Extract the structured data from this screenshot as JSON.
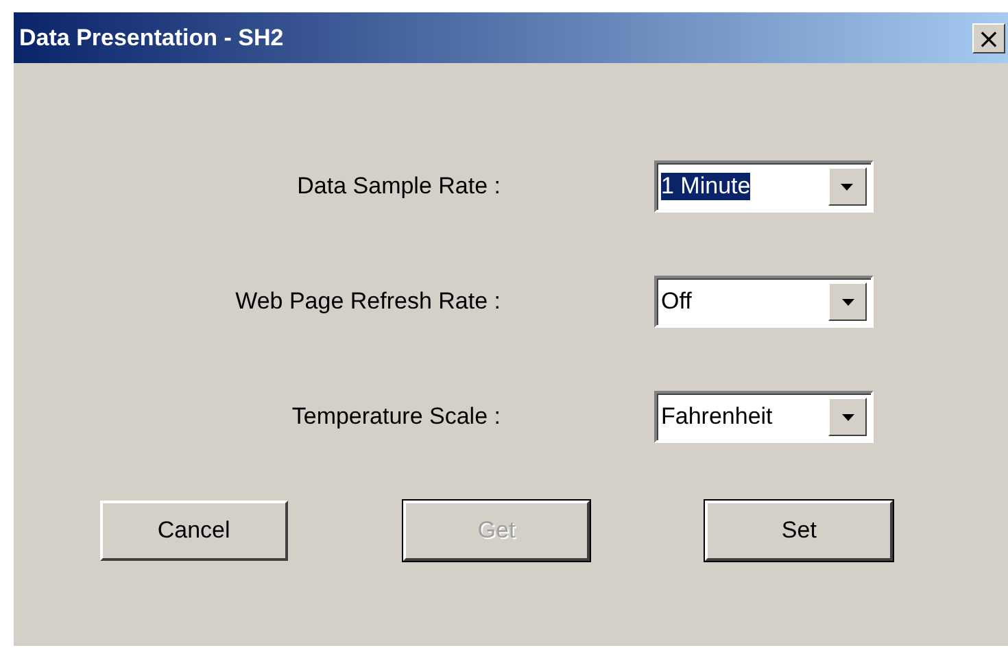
{
  "window": {
    "title": "Data Presentation - SH2",
    "close_icon": "×"
  },
  "settings": [
    {
      "label": "Data Sample Rate :",
      "value": "1 Minute",
      "focused": true
    },
    {
      "label": "Web Page Refresh Rate :",
      "value": "Off",
      "focused": false
    },
    {
      "label": "Temperature Scale :",
      "value": "Fahrenheit",
      "focused": false
    }
  ],
  "buttons": [
    {
      "label": "Cancel",
      "disabled": false,
      "default": false
    },
    {
      "label": "Get",
      "disabled": true,
      "default": true
    },
    {
      "label": "Set",
      "disabled": false,
      "default": true
    }
  ]
}
